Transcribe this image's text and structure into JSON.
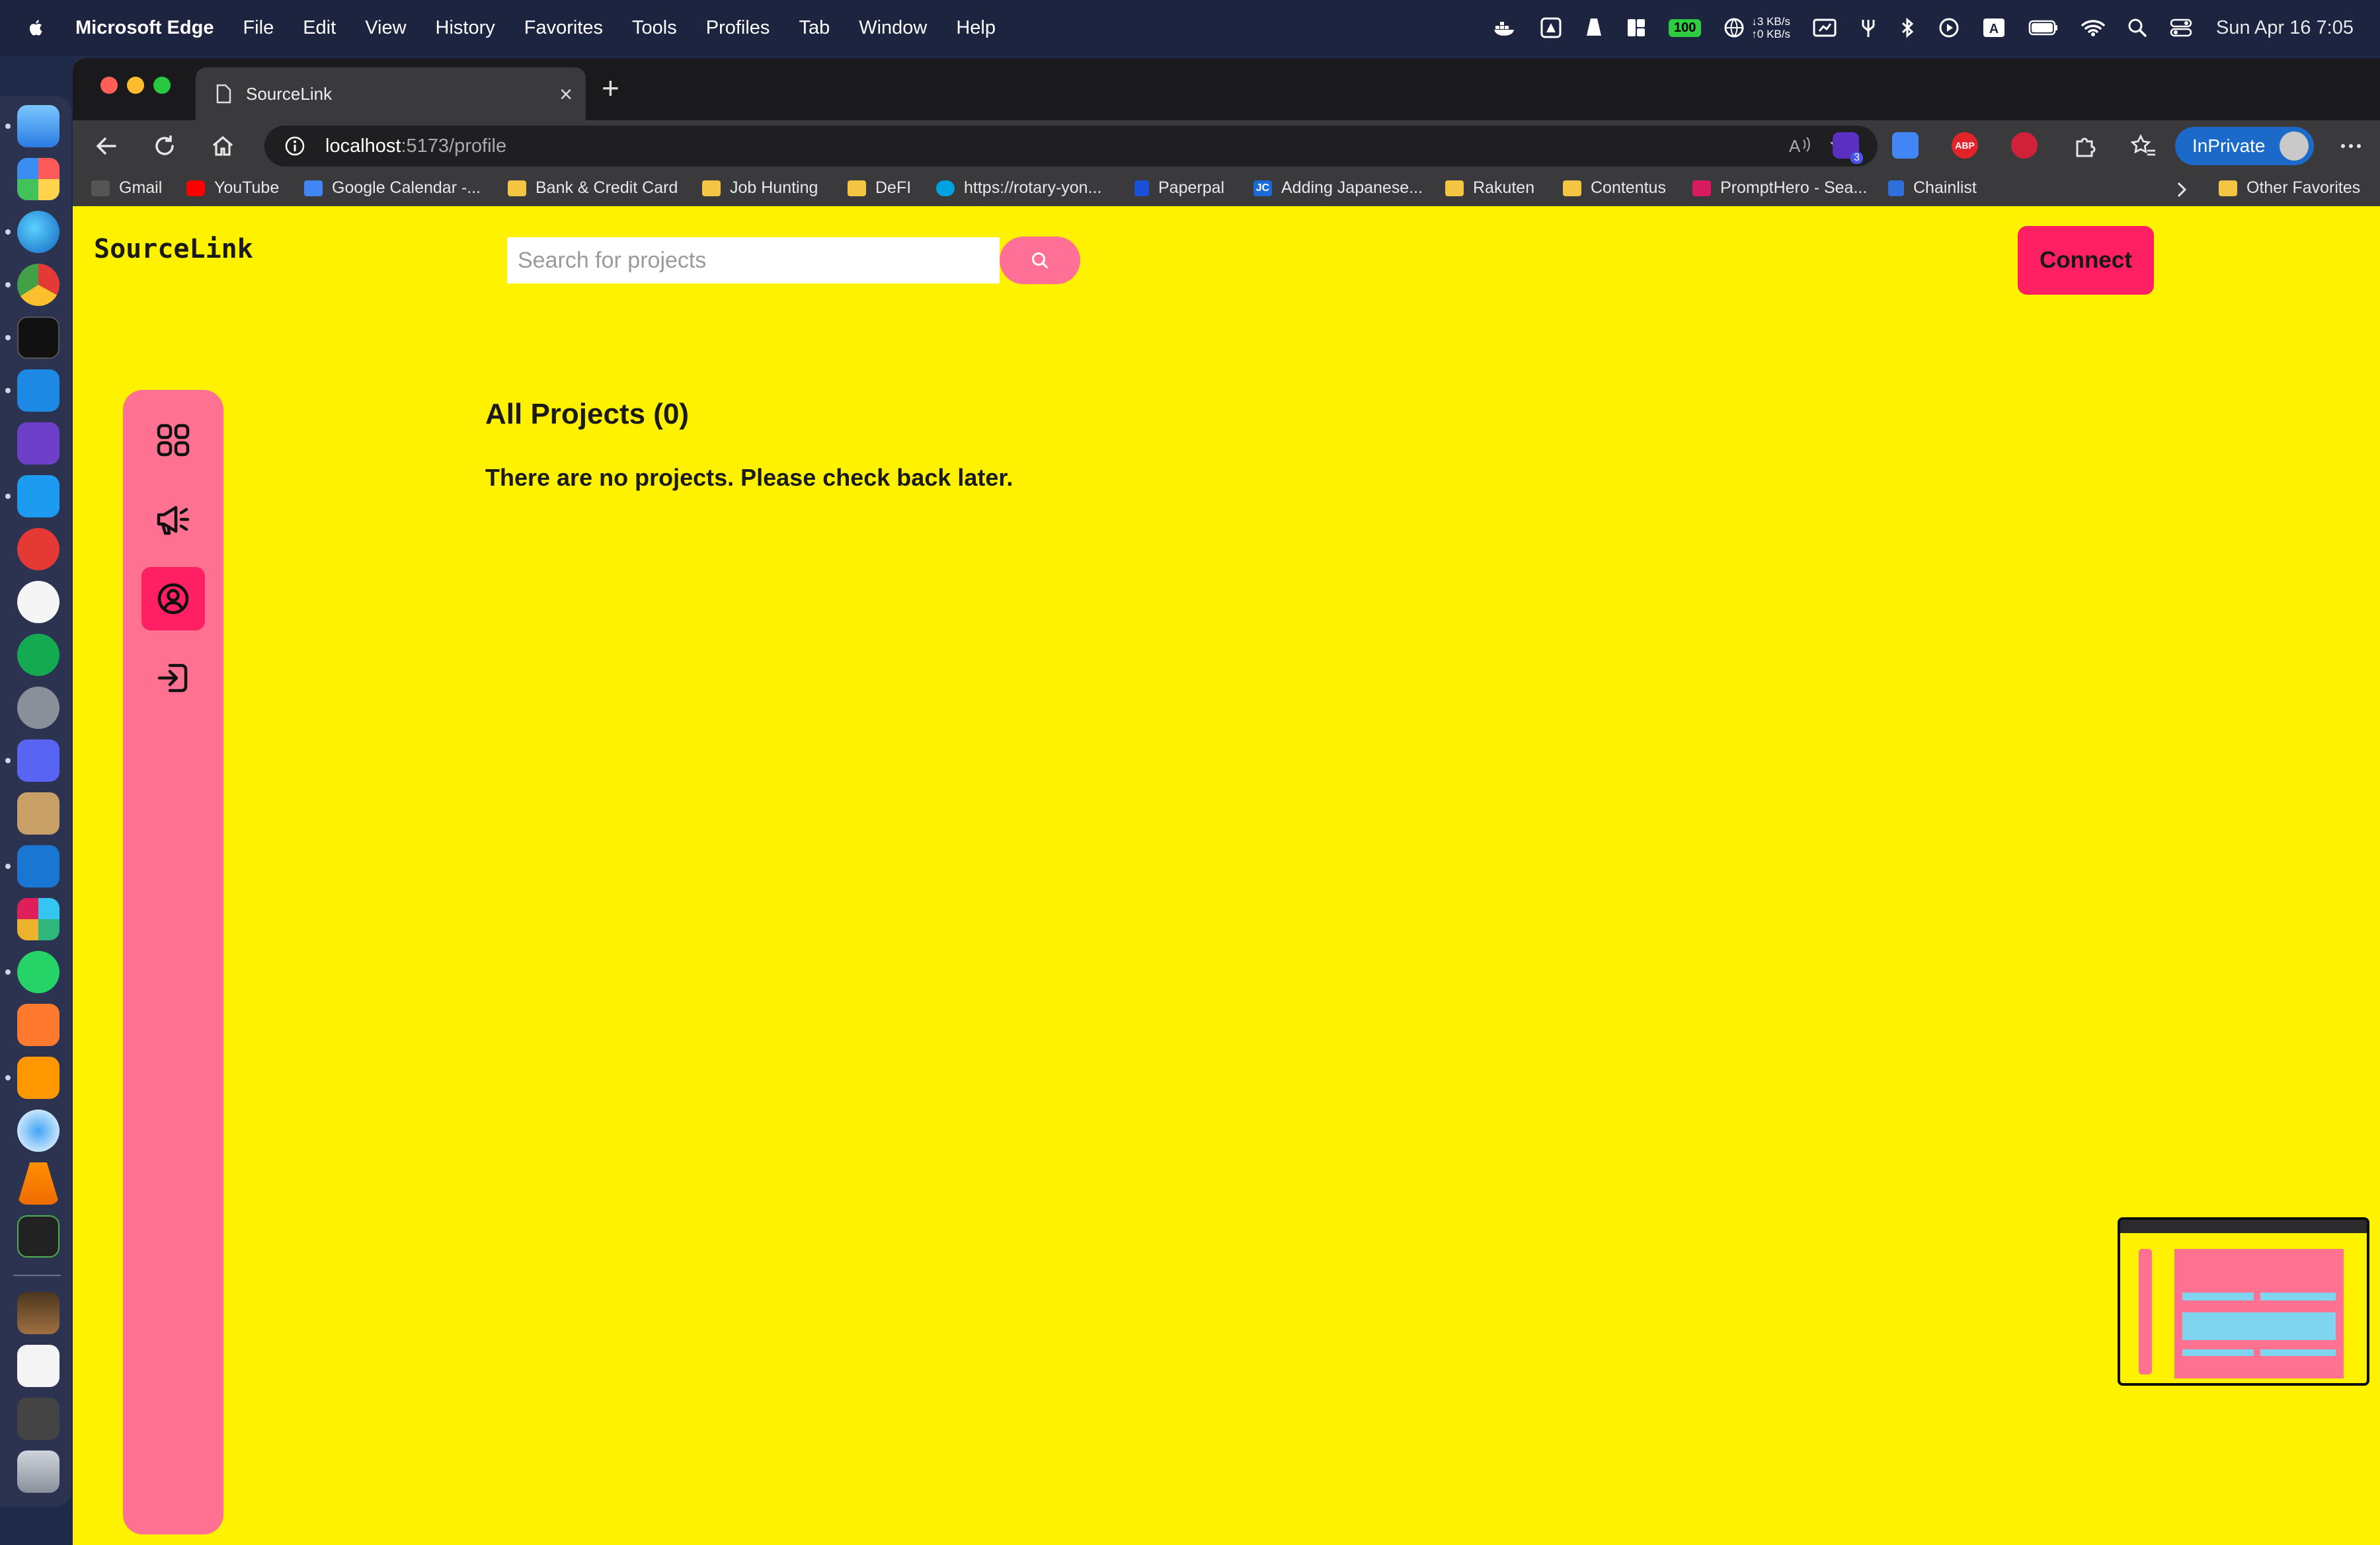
{
  "menubar": {
    "app_name": "Microsoft Edge",
    "items": [
      "File",
      "Edit",
      "View",
      "History",
      "Favorites",
      "Tools",
      "Profiles",
      "Tab",
      "Window",
      "Help"
    ],
    "battery": "100",
    "net_up": "↓3 KB/s",
    "net_down": "↑0 KB/s",
    "clock": "Sun Apr 16  7:05"
  },
  "browser": {
    "tab_title": "SourceLink",
    "url_host": "localhost",
    "url_path": ":5173/profile",
    "inprivate_label": "InPrivate",
    "extension_badge": "3",
    "abp_label": "ABP"
  },
  "favorites": [
    {
      "label": "Gmail",
      "icon": "gmail-icon"
    },
    {
      "label": "YouTube",
      "icon": "youtube-icon"
    },
    {
      "label": "Google Calendar -...",
      "icon": "calendar-icon"
    },
    {
      "label": "Bank & Credit Card",
      "icon": "folder-icon"
    },
    {
      "label": "Job Hunting",
      "icon": "folder-icon"
    },
    {
      "label": "DeFI",
      "icon": "folder-icon"
    },
    {
      "label": "https://rotary-yon...",
      "icon": "cloud-icon"
    },
    {
      "label": "Paperpal",
      "icon": "paperpal-icon"
    },
    {
      "label": "Adding Japanese...",
      "icon": "jc-icon"
    },
    {
      "label": "Rakuten",
      "icon": "folder-icon"
    },
    {
      "label": "Contentus",
      "icon": "folder-icon"
    },
    {
      "label": "PromptHero - Sea...",
      "icon": "prompthero-icon"
    },
    {
      "label": "Chainlist",
      "icon": "chainlist-icon"
    }
  ],
  "other_favorites": "Other Favorites",
  "jc_badge": "JC",
  "page": {
    "logo": "SourceLink",
    "search_placeholder": "Search for projects",
    "connect_label": "Connect",
    "heading": "All Projects (0)",
    "empty_message": "There are no projects. Please check back later."
  },
  "colors": {
    "page_background": "#fff200",
    "sidebar": "#ff7190",
    "accent": "#ff1f63",
    "search_button": "#ff6f96"
  }
}
